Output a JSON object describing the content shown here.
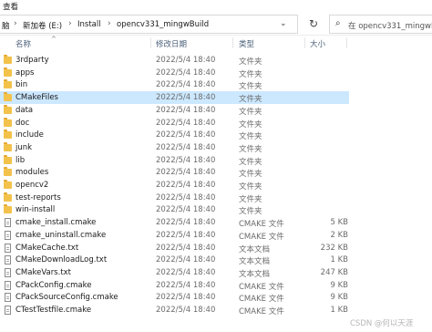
{
  "menu": {
    "view_label": "查看"
  },
  "address": {
    "breadcrumbs": [
      "脑",
      "新加卷 (E:)",
      "Install",
      "opencv331_mingwBuild"
    ],
    "separator": "›"
  },
  "search": {
    "placeholder": "在 opencv331_mingwBuild"
  },
  "columns": {
    "name": "名称",
    "date": "修改日期",
    "type": "类型",
    "size": "大小"
  },
  "files": [
    {
      "name": "3rdparty",
      "date": "2022/5/4 18:40",
      "type": "文件夹",
      "size": "",
      "kind": "folder"
    },
    {
      "name": "apps",
      "date": "2022/5/4 18:40",
      "type": "文件夹",
      "size": "",
      "kind": "folder"
    },
    {
      "name": "bin",
      "date": "2022/5/4 18:40",
      "type": "文件夹",
      "size": "",
      "kind": "folder"
    },
    {
      "name": "CMakeFiles",
      "date": "2022/5/4 18:40",
      "type": "文件夹",
      "size": "",
      "kind": "folder"
    },
    {
      "name": "data",
      "date": "2022/5/4 18:40",
      "type": "文件夹",
      "size": "",
      "kind": "folder"
    },
    {
      "name": "doc",
      "date": "2022/5/4 18:40",
      "type": "文件夹",
      "size": "",
      "kind": "folder"
    },
    {
      "name": "include",
      "date": "2022/5/4 18:40",
      "type": "文件夹",
      "size": "",
      "kind": "folder"
    },
    {
      "name": "junk",
      "date": "2022/5/4 18:40",
      "type": "文件夹",
      "size": "",
      "kind": "folder"
    },
    {
      "name": "lib",
      "date": "2022/5/4 18:40",
      "type": "文件夹",
      "size": "",
      "kind": "folder"
    },
    {
      "name": "modules",
      "date": "2022/5/4 18:40",
      "type": "文件夹",
      "size": "",
      "kind": "folder"
    },
    {
      "name": "opencv2",
      "date": "2022/5/4 18:40",
      "type": "文件夹",
      "size": "",
      "kind": "folder"
    },
    {
      "name": "test-reports",
      "date": "2022/5/4 18:40",
      "type": "文件夹",
      "size": "",
      "kind": "folder"
    },
    {
      "name": "win-install",
      "date": "2022/5/4 18:40",
      "type": "文件夹",
      "size": "",
      "kind": "folder"
    },
    {
      "name": "cmake_install.cmake",
      "date": "2022/5/4 18:40",
      "type": "CMAKE 文件",
      "size": "5 KB",
      "kind": "file"
    },
    {
      "name": "cmake_uninstall.cmake",
      "date": "2022/5/4 18:40",
      "type": "CMAKE 文件",
      "size": "2 KB",
      "kind": "file"
    },
    {
      "name": "CMakeCache.txt",
      "date": "2022/5/4 18:40",
      "type": "文本文档",
      "size": "232 KB",
      "kind": "file"
    },
    {
      "name": "CMakeDownloadLog.txt",
      "date": "2022/5/4 18:40",
      "type": "文本文档",
      "size": "1 KB",
      "kind": "file"
    },
    {
      "name": "CMakeVars.txt",
      "date": "2022/5/4 18:40",
      "type": "文本文档",
      "size": "247 KB",
      "kind": "file"
    },
    {
      "name": "CPackConfig.cmake",
      "date": "2022/5/4 18:40",
      "type": "CMAKE 文件",
      "size": "9 KB",
      "kind": "file"
    },
    {
      "name": "CPackSourceConfig.cmake",
      "date": "2022/5/4 18:40",
      "type": "CMAKE 文件",
      "size": "9 KB",
      "kind": "file"
    },
    {
      "name": "CTestTestfile.cmake",
      "date": "2022/5/4 18:40",
      "type": "CMAKE 文件",
      "size": "1 KB",
      "kind": "file"
    }
  ],
  "selected_row": "CMakeFiles",
  "watermark": "CSDN @何以天涯",
  "icons": {
    "folder": "folder-icon",
    "file": "file-icon",
    "refresh": "refresh-icon",
    "search": "search-icon",
    "dropdown": "chevron-down-icon"
  }
}
